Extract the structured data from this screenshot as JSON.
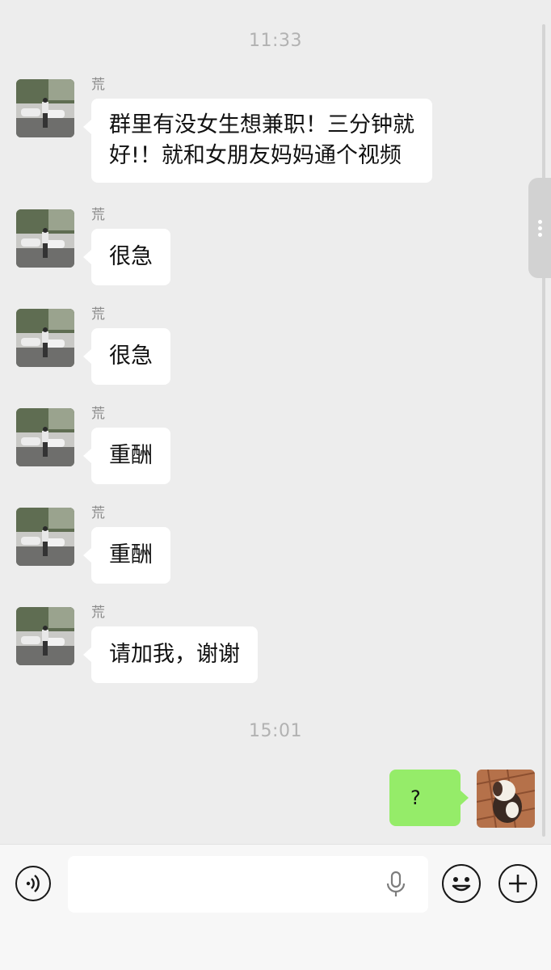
{
  "chat": {
    "timestamps": [
      "11:33",
      "15:01"
    ],
    "messages": [
      {
        "sender": "荒",
        "lines": [
          "群里有没女生想兼职！三分钟就",
          "好!！就和女朋友妈妈通个视频"
        ]
      },
      {
        "sender": "荒",
        "lines": [
          "很急"
        ]
      },
      {
        "sender": "荒",
        "lines": [
          "很急"
        ]
      },
      {
        "sender": "荒",
        "lines": [
          "重酬"
        ]
      },
      {
        "sender": "荒",
        "lines": [
          "重酬"
        ]
      },
      {
        "sender": "荒",
        "lines": [
          "请加我，谢谢"
        ]
      }
    ],
    "outgoing": {
      "text": "?"
    }
  },
  "input_bar": {
    "voice_icon": "voice-icon",
    "mic_icon": "microphone-icon",
    "emoji_icon": "emoji-icon",
    "plus_icon": "plus-icon",
    "placeholder": ""
  },
  "colors": {
    "background": "#ededed",
    "incoming_bubble": "#ffffff",
    "outgoing_bubble": "#95ec69",
    "timestamp": "#b2b2b2"
  }
}
